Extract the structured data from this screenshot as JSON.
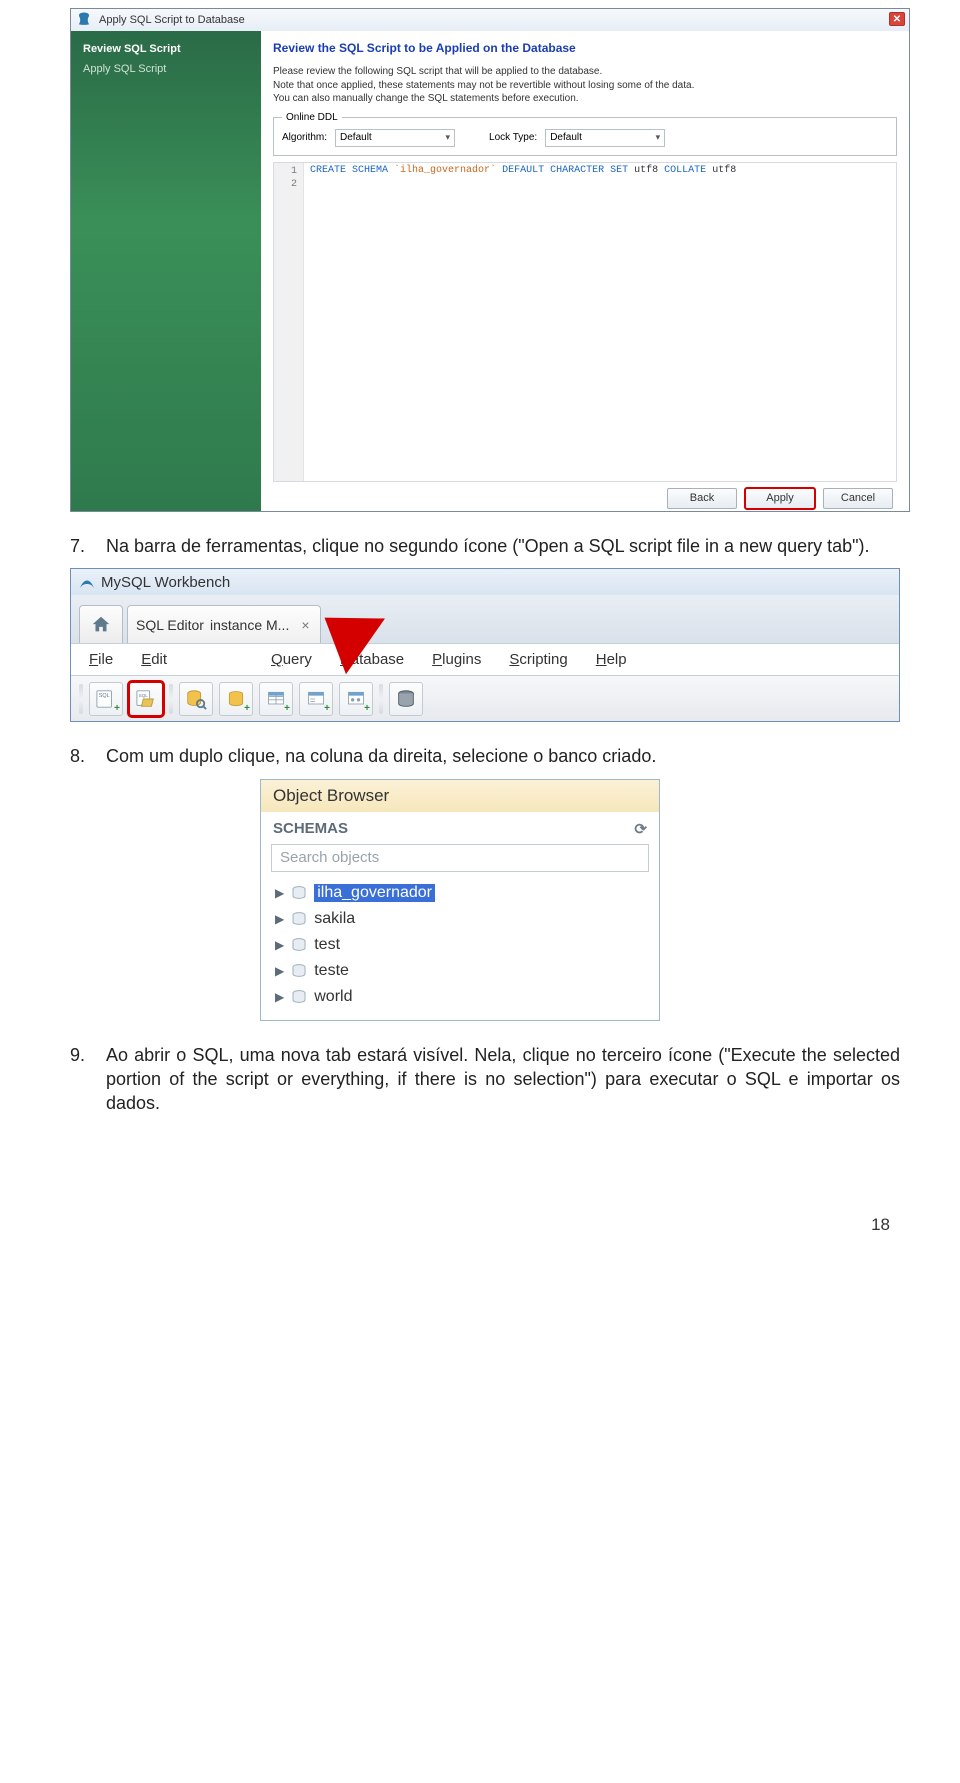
{
  "dialog": {
    "title": "Apply SQL Script to Database",
    "sidebar": {
      "active": "Review SQL Script",
      "inactive": "Apply SQL Script"
    },
    "heading": "Review the SQL Script to be Applied on the Database",
    "desc1": "Please review the following SQL script that will be applied to the database.",
    "desc2": "Note that once applied, these statements may not be revertible without losing some of the data.",
    "desc3": "You can also manually change the SQL statements before execution.",
    "ddl": {
      "legend": "Online DDL",
      "algo_label": "Algorithm:",
      "algo_value": "Default",
      "lock_label": "Lock Type:",
      "lock_value": "Default"
    },
    "gutter": [
      "1",
      "2"
    ],
    "sql_kw1": "CREATE SCHEMA",
    "sql_str": "`ilha_governador`",
    "sql_kw2": "DEFAULT CHARACTER SET",
    "sql_id1": "utf8",
    "sql_kw3": "COLLATE",
    "sql_id2": "utf8",
    "buttons": {
      "back": "Back",
      "apply": "Apply",
      "cancel": "Cancel"
    }
  },
  "doc": {
    "p7_num": "7.",
    "p7": "Na barra de ferramentas, clique no segundo ícone (\"Open a SQL script file in a new query tab\").",
    "p8_num": "8.",
    "p8": "Com um duplo clique, na coluna da direita, selecione o banco criado.",
    "p9_num": "9.",
    "p9": "Ao abrir o SQL, uma nova tab estará visível. Nela, clique no terceiro ícone (\"Execute the selected portion of the script or everything, if there is no selection\") para executar o SQL e importar os dados.",
    "page_no": "18"
  },
  "workbench": {
    "title": "MySQL Workbench",
    "tab_prefix": "SQL Editor",
    "tab_suffix": "instance M...",
    "menu": {
      "file": "File",
      "edit": "Edit",
      "query": "Query",
      "database": "Database",
      "plugins": "Plugins",
      "scripting": "Scripting",
      "help": "Help"
    }
  },
  "object_browser": {
    "title": "Object Browser",
    "head": "SCHEMAS",
    "search_placeholder": "Search objects",
    "items": [
      "ilha_governador",
      "sakila",
      "test",
      "teste",
      "world"
    ]
  }
}
